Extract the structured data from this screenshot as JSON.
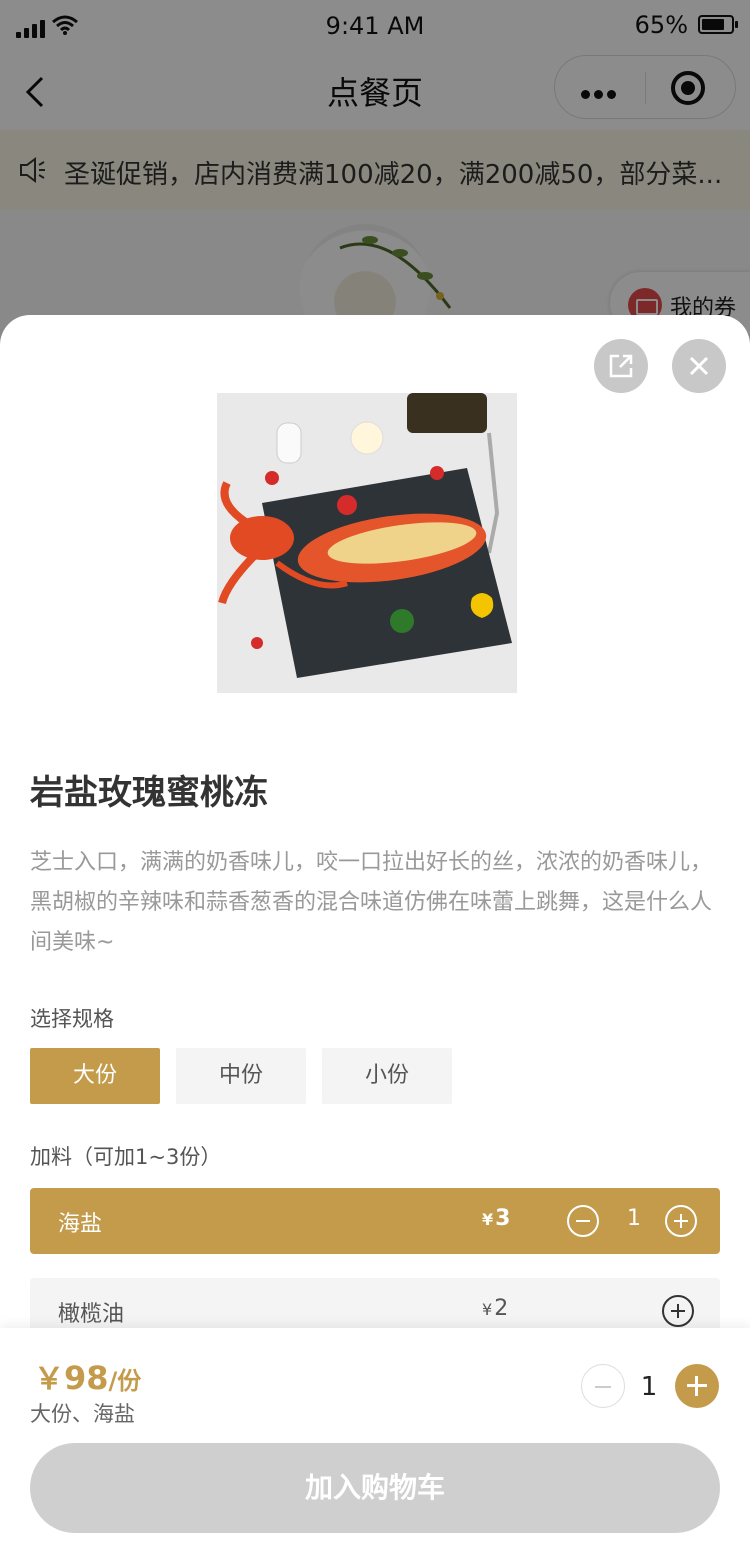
{
  "status_bar": {
    "time": "9:41 AM",
    "battery": "65%"
  },
  "nav": {
    "title": "点餐页"
  },
  "notice": {
    "icon": "speaker-icon",
    "text": "圣诞促销，店内消费满100减20，满200减50，部分菜..."
  },
  "coupon": {
    "label": "我的券"
  },
  "dish": {
    "name": "岩盐玫瑰蜜桃冻",
    "description": "芝士入口，满满的奶香味儿，咬一口拉出好长的丝，浓浓的奶香味儿，黑胡椒的辛辣味和蒜香葱香的混合味道仿佛在味蕾上跳舞，这是什么人间美味~"
  },
  "spec": {
    "label": "选择规格",
    "options": [
      {
        "label": "大份",
        "selected": true
      },
      {
        "label": "中份",
        "selected": false
      },
      {
        "label": "小份",
        "selected": false
      }
    ]
  },
  "addons": {
    "label": "加料（可加1~3份）",
    "items": [
      {
        "name": "海盐",
        "currency": "¥",
        "price": "3",
        "qty": "1",
        "selected": true
      },
      {
        "name": "橄榄油",
        "currency": "¥",
        "price": "2",
        "qty": "0",
        "selected": false
      }
    ]
  },
  "footer": {
    "currency": "￥",
    "price": "98",
    "unit": "/份",
    "summary": "大份、海盐",
    "quantity": "1",
    "add_to_cart": "加入购物车"
  },
  "colors": {
    "accent": "#c39b4a",
    "disabled": "#cfcfcf"
  }
}
